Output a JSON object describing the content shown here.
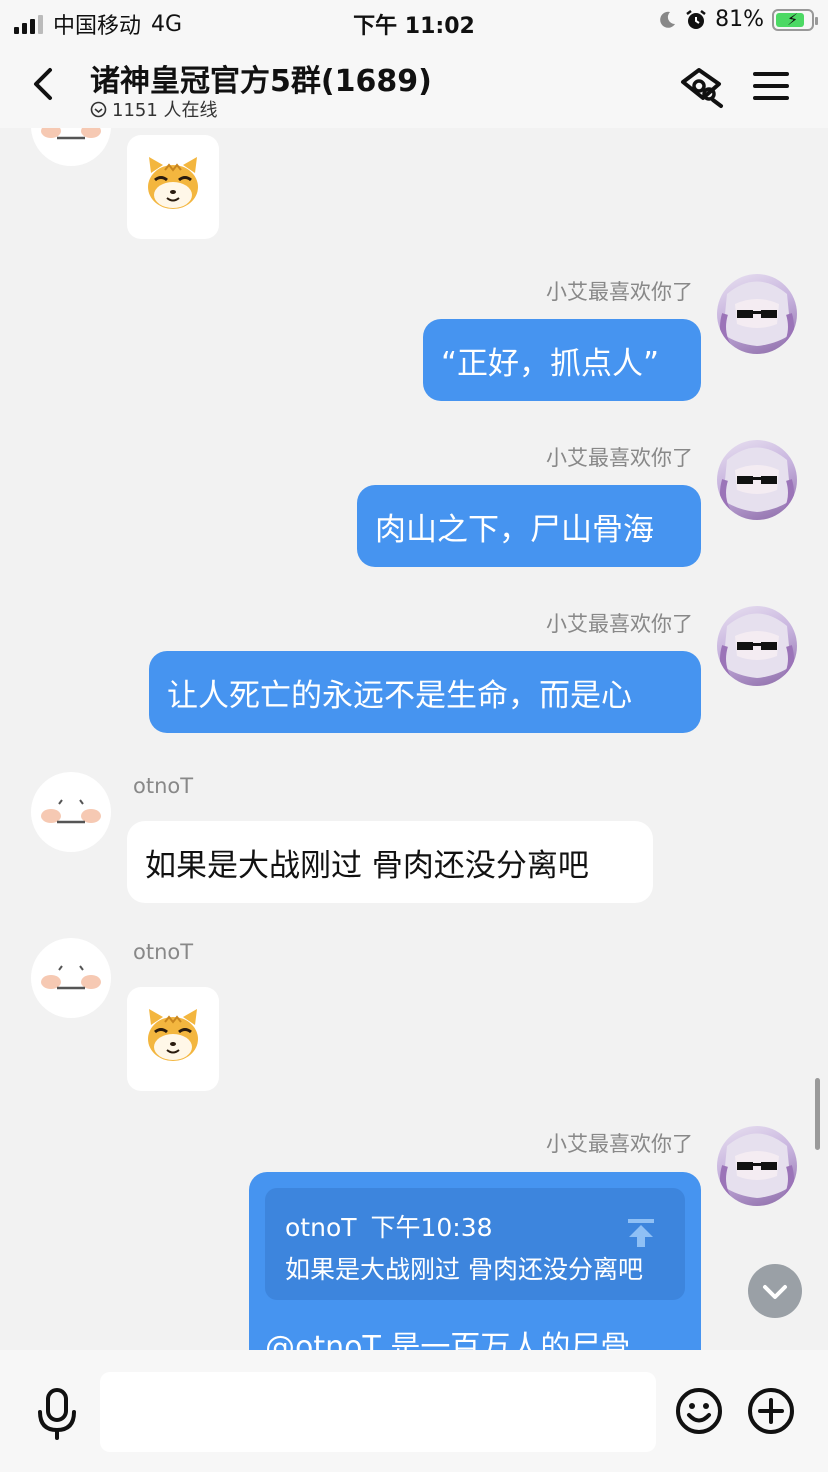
{
  "status_bar": {
    "carrier": "中国移动",
    "network": "4G",
    "time": "下午 11:02",
    "battery": "81%",
    "battery_level": 0.81
  },
  "header": {
    "title": "诸神皇冠官方5群(1689)",
    "online": "1151 人在线",
    "icons": [
      "back-icon",
      "anonymous-mask-icon",
      "menu-icon",
      "online-clock-icon"
    ]
  },
  "messages": [
    {
      "sender": "otnoT",
      "self": false,
      "type": "sticker",
      "sticker": "cat-sticker"
    },
    {
      "sender": "小艾最喜欢你了",
      "self": true,
      "type": "text",
      "text": "“正好，抓点人”"
    },
    {
      "sender": "小艾最喜欢你了",
      "self": true,
      "type": "text",
      "text": "肉山之下，尸山骨海"
    },
    {
      "sender": "小艾最喜欢你了",
      "self": true,
      "type": "text",
      "text": "让人死亡的永远不是生命，而是心"
    },
    {
      "sender": "otnoT",
      "self": false,
      "type": "text",
      "text": "如果是大战刚过 骨肉还没分离吧"
    },
    {
      "sender": "otnoT",
      "self": false,
      "type": "sticker",
      "sticker": "cat-sticker"
    },
    {
      "sender": "小艾最喜欢你了",
      "self": true,
      "type": "reply",
      "quote": {
        "author": "otnoT",
        "time": "下午10:38",
        "text": "如果是大战刚过 骨肉还没分离吧"
      },
      "text": "@otnoT 是一百万人的尸骨"
    }
  ],
  "input": {
    "value": "",
    "placeholder": ""
  },
  "colors": {
    "bubble_self": "#4694f0",
    "bubble_other": "#ffffff",
    "background": "#f2f2f2"
  }
}
